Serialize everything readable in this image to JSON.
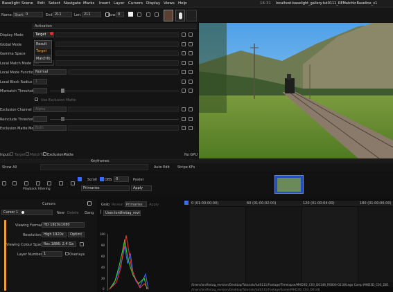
{
  "menubar": {
    "items": [
      "Baselight",
      "Scene",
      "Edit",
      "Select",
      "Navigate",
      "Marks",
      "Insert",
      "Layer",
      "Cursors",
      "Display",
      "Views",
      "Help"
    ],
    "clock": "16:31",
    "host": "localhost:baselight_gallery.tut0111_REMatchInBaseline_v1"
  },
  "shot": {
    "name_label": "Name:",
    "start_label": "Start:",
    "start_value": "0",
    "end_label": "End:",
    "end_value": "211",
    "len_label": "Len:",
    "len_value": "211",
    "row_label": "Row:",
    "row_value": "0"
  },
  "operator": {
    "tab": "Activation",
    "display_mode_label": "Display Mode",
    "display_mode_value": "Target",
    "global_mode_label": "Global Mode",
    "gamma_space_label": "Gamma Space",
    "local_match_mode_label": "Local Match Mode",
    "local_match_mode_value": "Gl",
    "local_mode_function_label": "Local Mode Function",
    "local_mode_function_value": "Normal",
    "local_block_radius_label": "Local Block Radius",
    "local_block_radius_value": "1",
    "mismatch_threshold_label": "Mismatch Threshold %",
    "use_exclusion_matte": "Use Exclusion Matte",
    "exclusion_channel_label": "Exclusion Channel",
    "exclusion_channel_value": "Alpha",
    "reinclude_threshold_label": "Reinclude Threshold %",
    "exclusion_matte_mode_label": "Exclusion Matte Mode",
    "exclusion_matte_mode_value": "Both",
    "inputs_label": "Inputs",
    "input_target": "Target",
    "input_matchto": "MatchTo",
    "input_exclusion": "ExclusionMatte",
    "gpu_status": "No GPU"
  },
  "dropdown": {
    "options": [
      "Result",
      "Target",
      "MatchTo"
    ],
    "selected": "Target"
  },
  "keyframes": {
    "title": "Keyframes",
    "show_all": "Show All",
    "auto_edit": "Auto Edit",
    "stripe_kfs": "Stripe KFs"
  },
  "transport": {
    "scroll": "Scroll",
    "dbs": "DBS",
    "dbs_value": "0",
    "poster": "Poster",
    "primaries": "Primaries",
    "apply": "Apply",
    "playback_filtering": "Playback Filtering"
  },
  "cursors": {
    "title": "Cursors",
    "cursor_name": "Cursor 1",
    "new_btn": "New",
    "delete_btn": "Delete",
    "gang_btn": "Gang",
    "viewing_format_label": "Viewing Format:",
    "viewing_format_value": "HD 1920x1080",
    "resolution_label": "Resolution:",
    "resolution_value": "High  1920x",
    "resolution_option": "Optimi",
    "colour_space_label": "Viewing Colour Space:",
    "colour_space_value": "Rec.1886: 2.4 Ga",
    "layer_number_label": "Layer Number:",
    "layer_number_value": "1",
    "overlays": "Overlays"
  },
  "scopes": {
    "tabs": [
      "Grab",
      "Reveal",
      "Primaries",
      "Apply"
    ],
    "preset": "User:lordfretag_revisio",
    "y_ticks": [
      "100",
      "80",
      "60",
      "40",
      "20",
      "0"
    ]
  },
  "timeline": {
    "ticks": [
      "0 (01:00:00:00)",
      "60 (01:00:02:00)",
      "120 (01:00:04:00)",
      "180 (01:00:06:00)"
    ],
    "path1": "/Users/lordfretag_revision/Desktop/Tutorials/tut0111/Footage/Timelapse/MHD3D_C03_D0148_R0000-0218/Lego Comp MHD3D_C03_D01",
    "path2": "/Users/lordfretag_revision/Desktop/Tutorials/tut0111/Footage/Scene/MHD3D_C03_D0148"
  },
  "colors": {
    "accent": "#f0a030",
    "red": "#ff3030",
    "green": "#30e030",
    "blue": "#3a6cff"
  }
}
